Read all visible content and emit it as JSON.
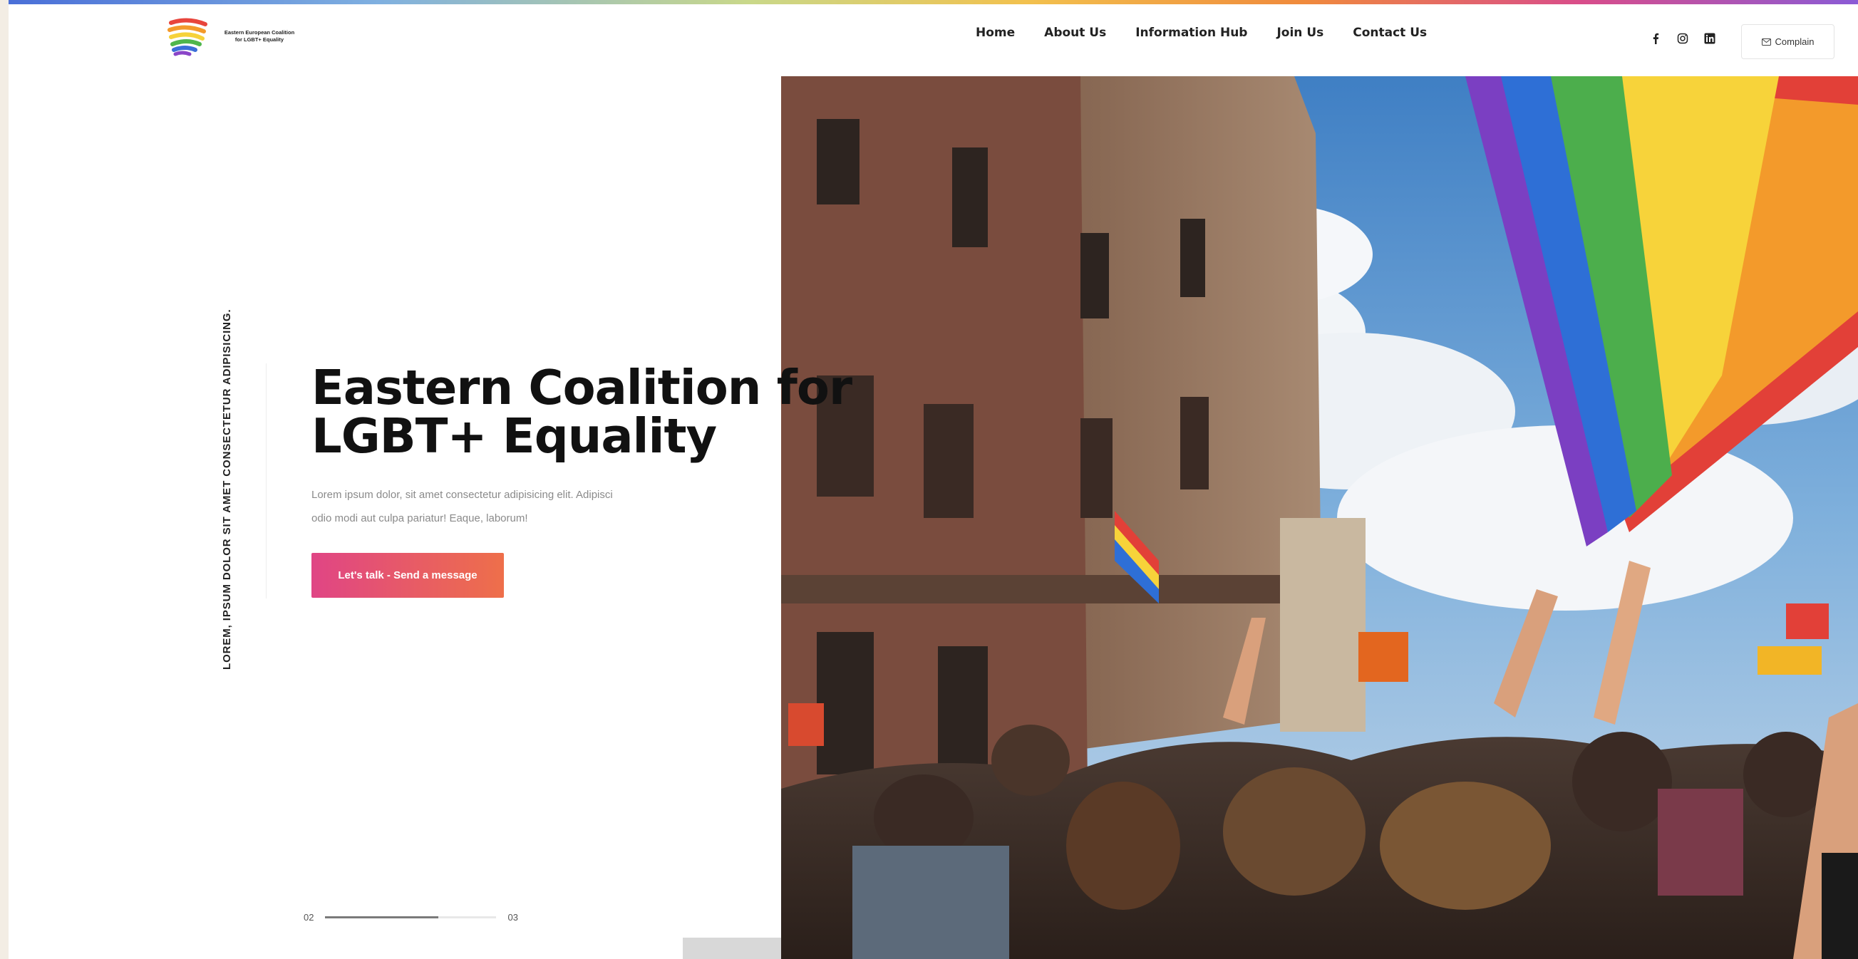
{
  "header": {
    "logo_line1": "Eastern European Coalition",
    "logo_line2": "for LGBT+ Equality",
    "nav": [
      "Home",
      "About Us",
      "Information Hub",
      "Join Us",
      "Contact Us"
    ],
    "socials": [
      "facebook-icon",
      "instagram-icon",
      "linkedin-icon"
    ],
    "complain_label": "Complain",
    "complain_icon": "mail-icon"
  },
  "hero": {
    "vertical_text": "LOREM, IPSUM DOLOR SIT AMET CONSECTETUR ADIPISICING.",
    "title_line1": "Eastern Coalition for",
    "title_line2": "LGBT+ Equality",
    "desc_line1": "Lorem ipsum dolor, sit amet consectetur adipisicing elit. Adipisci",
    "desc_line2": "odio modi aut culpa pariatur! Eaque, laborum!",
    "cta_label": "Let's talk - Send a message",
    "image_alt": "Pride parade crowd waving rainbow flags in front of historic building"
  },
  "slider": {
    "current": "02",
    "total": "03",
    "progress": 0.66
  },
  "colors": {
    "cta_start": "#e04585",
    "cta_end": "#ee6f4a",
    "text_dark": "#111111",
    "text_muted": "#8a8a8a"
  }
}
